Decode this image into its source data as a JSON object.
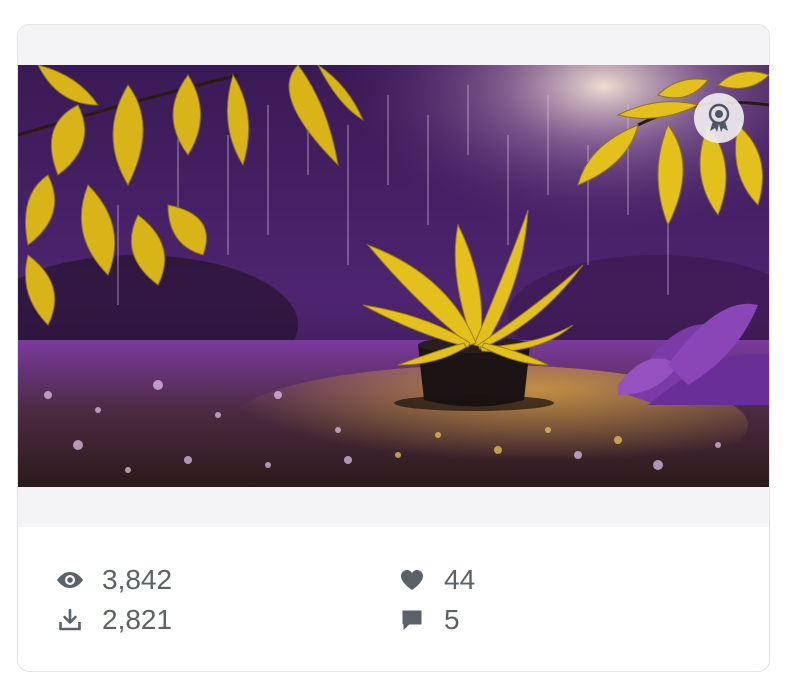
{
  "image": {
    "subject": "potted yellow plant in purple rain",
    "colors": {
      "accent_leaf": "#e3c01c",
      "accent_purple": "#5a2a7a"
    }
  },
  "badge": {
    "icon": "award-ribbon-icon"
  },
  "stats": {
    "views": {
      "icon": "eye-icon",
      "value": "3,842"
    },
    "downloads": {
      "icon": "download-icon",
      "value": "2,821"
    },
    "likes": {
      "icon": "heart-icon",
      "value": "44"
    },
    "comments": {
      "icon": "comment-icon",
      "value": "5"
    }
  },
  "colors": {
    "stat_text": "#5b6168",
    "card_border": "#e3e4e7",
    "media_bg": "#f4f4f6"
  }
}
